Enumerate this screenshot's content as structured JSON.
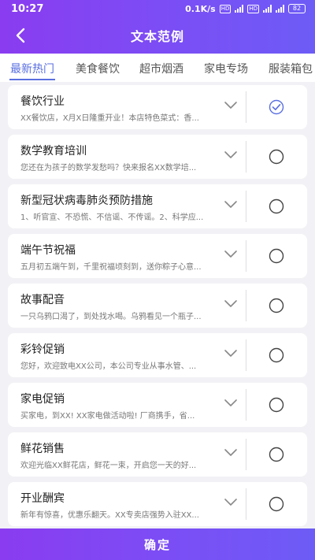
{
  "status": {
    "time": "10:27",
    "network": "0.1K/s",
    "battery": "82"
  },
  "header": {
    "title": "文本范例"
  },
  "tabs": [
    {
      "label": "最新热门",
      "active": true
    },
    {
      "label": "美食餐饮"
    },
    {
      "label": "超市烟酒"
    },
    {
      "label": "家电专场"
    },
    {
      "label": "服装箱包"
    }
  ],
  "items": [
    {
      "title": "餐饮行业",
      "desc": "XX餐饮店，X月X日隆重开业！本店特色菜式：香...",
      "selected": true
    },
    {
      "title": "数学教育培训",
      "desc": "您还在为孩子的数学发愁吗？快来报名XX数学培...",
      "selected": false
    },
    {
      "title": "新型冠状病毒肺炎预防措施",
      "desc": "1、听官宣、不恐慌、不信谣、不传谣。2、科学应...",
      "selected": false
    },
    {
      "title": "端午节祝福",
      "desc": "五月初五端午到，千里祝福顷刻到，送你粽子心意...",
      "selected": false
    },
    {
      "title": "故事配音",
      "desc": "一只乌鸦口渴了，到处找水喝。乌鸦看见一个瓶子...",
      "selected": false
    },
    {
      "title": "彩铃促销",
      "desc": "您好，欢迎致电XX公司，本公司专业从事水管、...",
      "selected": false
    },
    {
      "title": "家电促销",
      "desc": "买家电，到XX! XX家电做活动啦! 厂商携手，省...",
      "selected": false
    },
    {
      "title": "鲜花销售",
      "desc": "欢迎光临XX鲜花店，鲜花一束，开启您一天的好...",
      "selected": false
    },
    {
      "title": "开业酬宾",
      "desc": "新年有惊喜，优惠乐翻天。XX专卖店强势入驻XX...",
      "selected": false
    }
  ],
  "footer": {
    "confirm_label": "确定"
  },
  "colors": {
    "accent": "#5a6fe0",
    "brand_start": "#8a3cf0",
    "brand_end": "#6d5cf6"
  },
  "icons": {
    "back": "arrow-left-icon",
    "expand": "chevron-down-icon",
    "selected": "check-circle-icon",
    "unselected": "circle-icon"
  }
}
